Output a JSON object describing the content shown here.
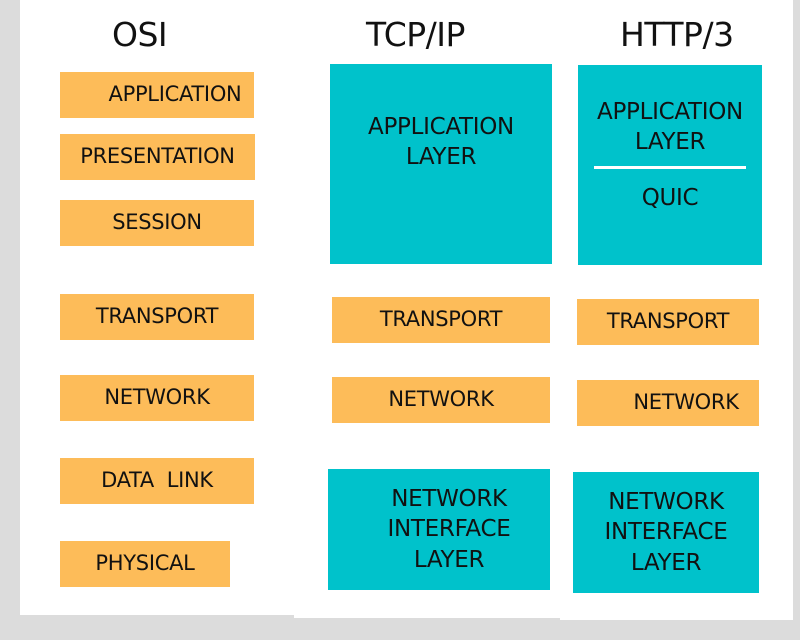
{
  "colors": {
    "session_layer": "#fdbc59",
    "grouped_layer": "#00c2cb",
    "background": "#dcdcdc"
  },
  "columns": {
    "osi": {
      "title": "OSI",
      "layers": [
        "APPLICATION",
        "PRESENTATION",
        "SESSION",
        "TRANSPORT",
        "NETWORK",
        "DATA  LINK",
        "PHYSICAL"
      ]
    },
    "tcpip": {
      "title": "TCP/IP",
      "layers": [
        {
          "lines": [
            "APPLICATION",
            "LAYER"
          ]
        },
        {
          "lines": [
            "TRANSPORT"
          ]
        },
        {
          "lines": [
            "NETWORK"
          ]
        },
        {
          "lines": [
            "NETWORK",
            "INTERFACE",
            "LAYER"
          ]
        }
      ]
    },
    "http3": {
      "title": "HTTP/3",
      "layers": [
        {
          "lines": [
            "APPLICATION",
            "LAYER"
          ],
          "sub": "QUIC"
        },
        {
          "lines": [
            "TRANSPORT"
          ]
        },
        {
          "lines": [
            "NETWORK"
          ]
        },
        {
          "lines": [
            "NETWORK",
            "INTERFACE",
            "LAYER"
          ]
        }
      ]
    }
  }
}
